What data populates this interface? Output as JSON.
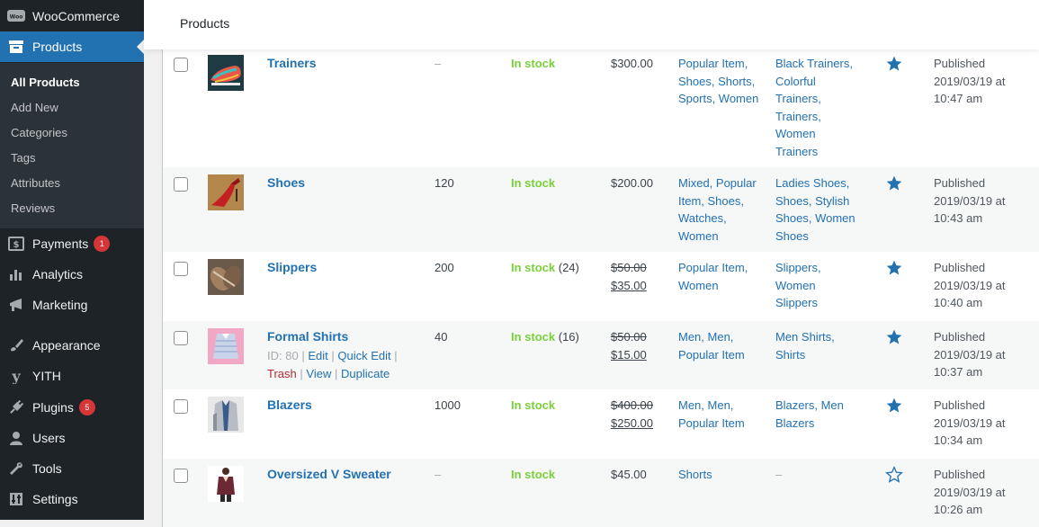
{
  "sidebar": {
    "brand": "WooCommerce",
    "current": "Products",
    "submenu": [
      "All Products",
      "Add New",
      "Categories",
      "Tags",
      "Attributes",
      "Reviews"
    ],
    "items": [
      {
        "label": "Payments",
        "badge": "1"
      },
      {
        "label": "Analytics"
      },
      {
        "label": "Marketing"
      },
      {
        "label": "Appearance"
      },
      {
        "label": "YITH"
      },
      {
        "label": "Plugins",
        "badge": "5"
      },
      {
        "label": "Users"
      },
      {
        "label": "Tools"
      },
      {
        "label": "Settings"
      }
    ]
  },
  "header": {
    "title": "Products"
  },
  "colors": {
    "accent": "#2271b1",
    "in_stock": "#7ad03a",
    "sidebar_bg": "#1d2327",
    "badge": "#d63638"
  },
  "rows": [
    {
      "name": "Trainers",
      "stock_qty": "–",
      "status": "In stock",
      "status_count": "",
      "price": "$300.00",
      "regular_price": "",
      "sale_price": "",
      "categories": [
        "Popular Item,",
        "Shoes, Shorts,",
        "Sports, Women"
      ],
      "tags": [
        "Black Trainers,",
        "Colorful",
        "Trainers,",
        "Trainers,",
        "Women",
        "Trainers"
      ],
      "featured": true,
      "published": [
        "Published",
        "2019/03/19 at",
        "10:47 am"
      ]
    },
    {
      "name": "Shoes",
      "stock_qty": "120",
      "status": "In stock",
      "status_count": "",
      "price": "$200.00",
      "regular_price": "",
      "sale_price": "",
      "categories": [
        "Mixed, Popular",
        "Item, Shoes,",
        "Watches,",
        "Women"
      ],
      "tags": [
        "Ladies Shoes,",
        "Shoes, Stylish",
        "Shoes, Women",
        "Shoes"
      ],
      "featured": true,
      "published": [
        "Published",
        "2019/03/19 at",
        "10:43 am"
      ]
    },
    {
      "name": "Slippers",
      "stock_qty": "200",
      "status": "In stock",
      "status_count": "(24)",
      "price": "",
      "regular_price": "$50.00",
      "sale_price": "$35.00",
      "categories": [
        "Popular Item,",
        "Women"
      ],
      "tags": [
        "Slippers,",
        "Women",
        "Slippers"
      ],
      "featured": true,
      "published": [
        "Published",
        "2019/03/19 at",
        "10:40 am"
      ]
    },
    {
      "name": "Formal Shirts",
      "stock_qty": "40",
      "status": "In stock",
      "status_count": "(16)",
      "price": "",
      "regular_price": "$50.00",
      "sale_price": "$15.00",
      "row_actions": {
        "id": "ID: 80",
        "edit": "Edit",
        "quick_edit": "Quick Edit",
        "trash": "Trash",
        "view": "View",
        "duplicate": "Duplicate"
      },
      "categories": [
        "Men, Men,",
        "Popular Item"
      ],
      "tags": [
        "Men Shirts,",
        "Shirts"
      ],
      "featured": true,
      "published": [
        "Published",
        "2019/03/19 at",
        "10:37 am"
      ]
    },
    {
      "name": "Blazers",
      "stock_qty": "1000",
      "status": "In stock",
      "status_count": "",
      "price": "",
      "regular_price": "$400.00",
      "sale_price": "$250.00",
      "categories": [
        "Men, Men,",
        "Popular Item"
      ],
      "tags": [
        "Blazers, Men",
        "Blazers"
      ],
      "featured": true,
      "published": [
        "Published",
        "2019/03/19 at",
        "10:34 am"
      ]
    },
    {
      "name": "Oversized V Sweater",
      "stock_qty": "–",
      "status": "In stock",
      "status_count": "",
      "price": "$45.00",
      "regular_price": "",
      "sale_price": "",
      "categories": [
        "Shorts"
      ],
      "tags": [
        "–"
      ],
      "featured": false,
      "published": [
        "Published",
        "2019/03/19 at",
        "10:26 am"
      ]
    }
  ]
}
